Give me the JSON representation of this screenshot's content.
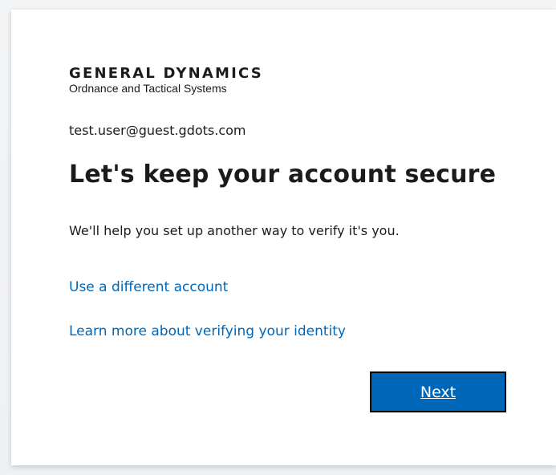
{
  "org": {
    "name": "GENERAL DYNAMICS",
    "division": "Ordnance and Tactical Systems"
  },
  "account": {
    "email": "test.user@guest.gdots.com"
  },
  "content": {
    "title": "Let's keep your account secure",
    "description": "We'll help you set up another way to verify it's you."
  },
  "links": {
    "different_account": "Use a different account",
    "learn_more": "Learn more about verifying your identity"
  },
  "actions": {
    "next_label": "Next"
  },
  "colors": {
    "link": "#0067b8",
    "primary_button": "#0067b8",
    "text": "#1b1b1b",
    "background": "#ffffff"
  }
}
